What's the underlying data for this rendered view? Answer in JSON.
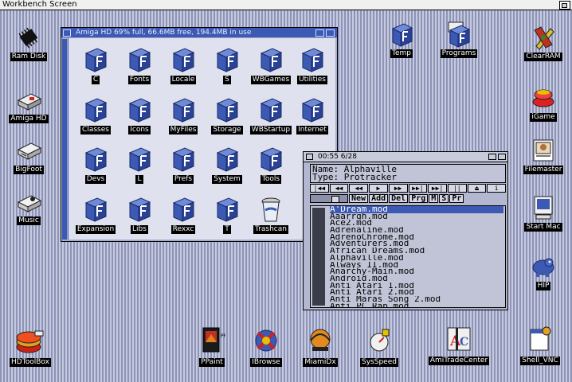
{
  "screen": {
    "title": "Workbench Screen"
  },
  "colors": {
    "window_blue": "#3c5ab4",
    "desktop_stripe_dark": "#8e93b8",
    "desktop_stripe_light": "#c6cade"
  },
  "desktop_left": [
    {
      "label": "Ram Disk",
      "icon": "chip-icon"
    },
    {
      "label": "Amiga HD",
      "icon": "harddisk-icon"
    },
    {
      "label": "BigFoot",
      "icon": "drive-icon"
    },
    {
      "label": "Music",
      "icon": "music-icon"
    }
  ],
  "desktop_top": [
    {
      "label": "Temp",
      "icon": "drawer-icon"
    },
    {
      "label": "Programs",
      "icon": "drawer-icon"
    }
  ],
  "desktop_right": [
    {
      "label": "ClearRAM",
      "icon": "tools-icon"
    },
    {
      "label": "iGame",
      "icon": "joystick-icon"
    },
    {
      "label": "Filemaster",
      "icon": "filemaster-icon"
    },
    {
      "label": "Start Mac",
      "icon": "mac-icon"
    },
    {
      "label": "HIP",
      "icon": "hippo-icon"
    }
  ],
  "drawer_window": {
    "title": "Amiga HD  69% full, 66.6MB free, 194.4MB in use",
    "icons": [
      {
        "label": "C"
      },
      {
        "label": "Fonts"
      },
      {
        "label": "Locale"
      },
      {
        "label": "S"
      },
      {
        "label": "WBGames"
      },
      {
        "label": "Utilities"
      },
      {
        "label": "Classes"
      },
      {
        "label": "Icons"
      },
      {
        "label": "MyFiles"
      },
      {
        "label": "Storage"
      },
      {
        "label": "WBStartup"
      },
      {
        "label": "Internet"
      },
      {
        "label": "Devs"
      },
      {
        "label": "L"
      },
      {
        "label": "Prefs"
      },
      {
        "label": "System"
      },
      {
        "label": "Tools"
      },
      {
        "label": "Expansion"
      },
      {
        "label": "Libs"
      },
      {
        "label": "Rexxc"
      },
      {
        "label": "T"
      },
      {
        "label": "Trashcan"
      }
    ]
  },
  "player": {
    "title": "00:55 6/28",
    "name_line": "Name: Alphaville",
    "type_line": "Type: Protracker",
    "controls": [
      "|◀◀",
      "◀◀",
      "◀◀",
      "▶",
      "▶▶",
      "▶▶|",
      "▶▶|",
      "||",
      "⏏",
      "i"
    ],
    "buttons": [
      "New",
      "Add",
      "Del",
      "Prg",
      "M",
      "S",
      "Pr"
    ],
    "files": [
      "A'Dream.mod",
      "Aaarrgh.mod",
      "Ace2.mod",
      "Adrenaline.mod",
      "AdrenoChrome.mod",
      "Adventurers.mod",
      "African Dreams.mod",
      "Alphaville.mod",
      "Always II.mod",
      "Anarchy-Main.mod",
      "Android.mod",
      "Anti Atari 1.mod",
      "Anti Atari 2.mod",
      "Anti Maras Song 2.mod",
      "Anti PC Rap.mod",
      "AProject14.mod"
    ],
    "selected_index": 0
  },
  "bottom_icons": [
    {
      "label": "HDToolBox",
      "icon": "hdtoolbox-icon"
    },
    {
      "label": "PPaint",
      "icon": "ppaint-icon"
    },
    {
      "label": "IBrowse",
      "icon": "ibrowse-icon"
    },
    {
      "label": "MiamiDx",
      "icon": "miami-icon"
    },
    {
      "label": "SysSpeed",
      "icon": "sysspeed-icon"
    },
    {
      "label": "AmiTradeCenter",
      "icon": "atc-icon"
    },
    {
      "label": "Shell_VNC",
      "icon": "shell-icon"
    }
  ]
}
